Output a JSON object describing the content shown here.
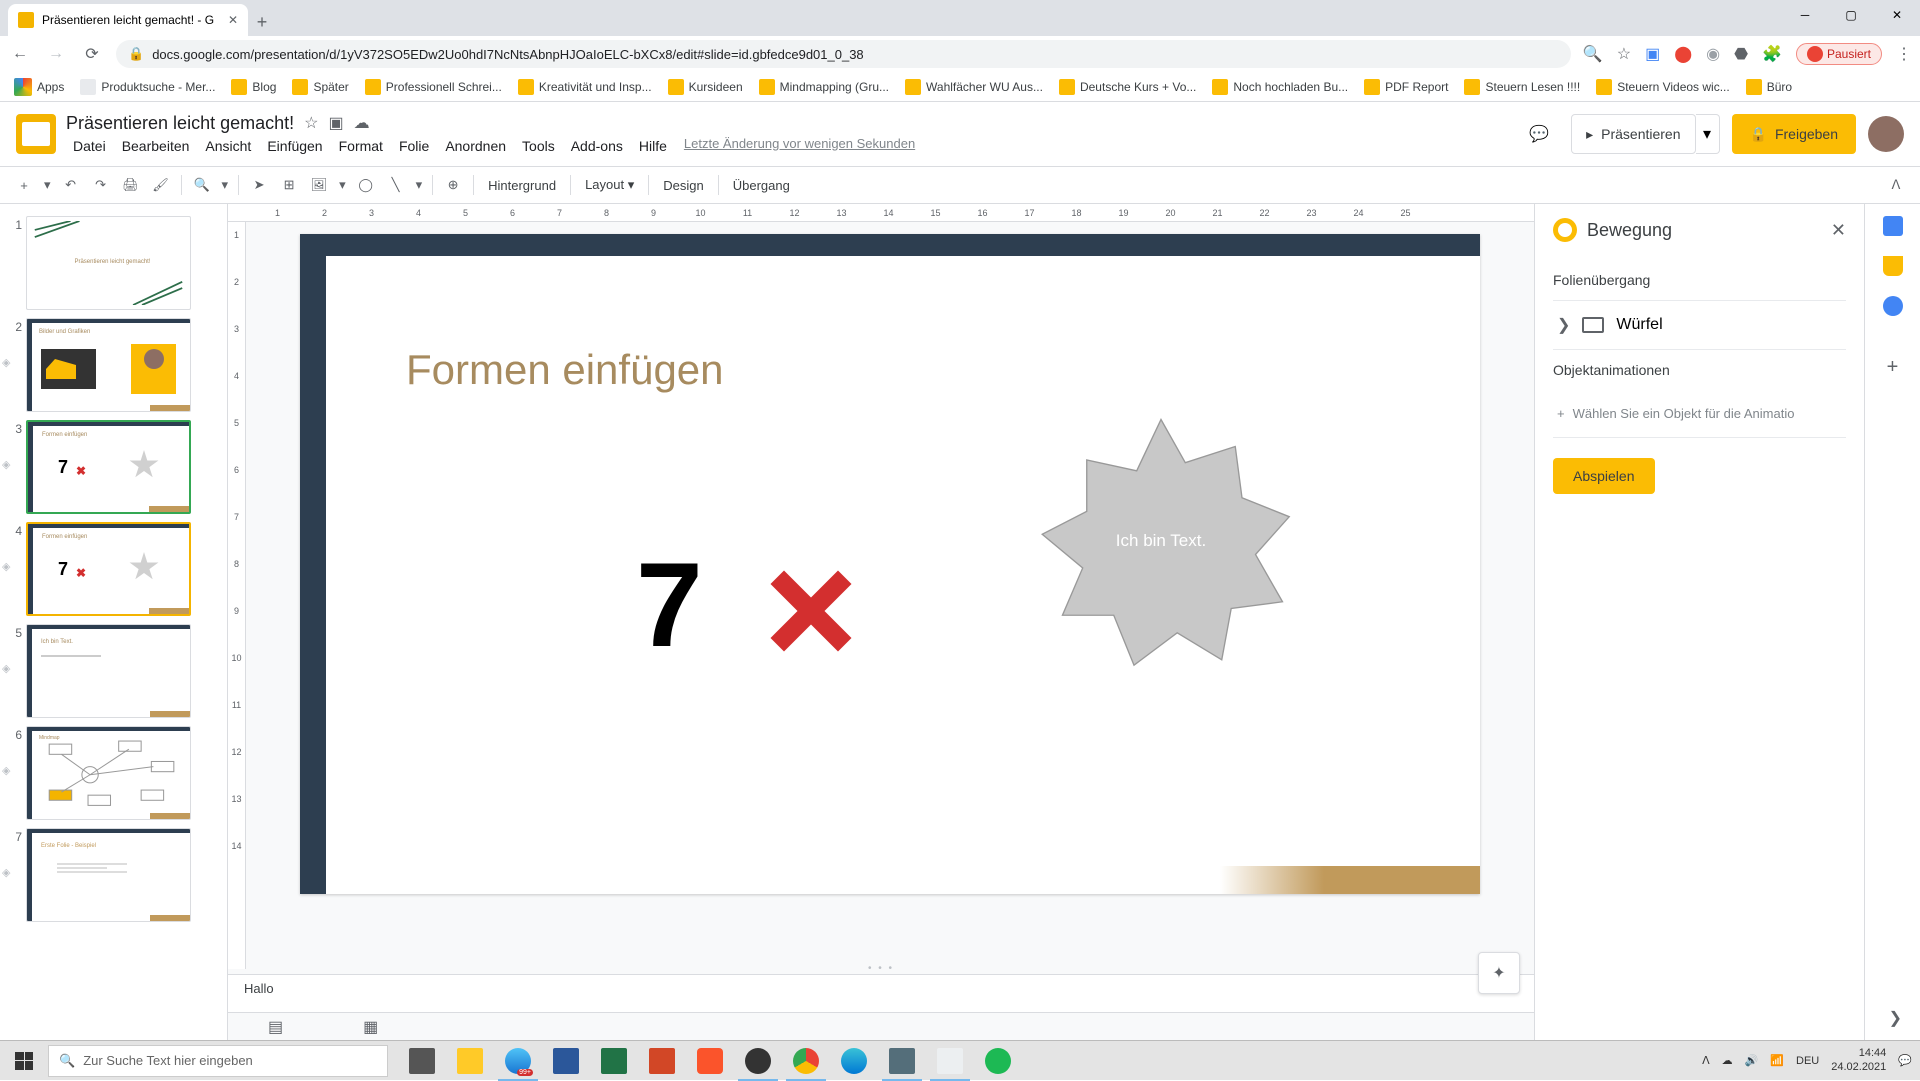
{
  "browser": {
    "tab_title": "Präsentieren leicht gemacht! - G",
    "url": "docs.google.com/presentation/d/1yV372SO5EDw2Uo0hdI7NcNtsAbnpHJOaIoELC-bXCx8/edit#slide=id.gbfedce9d01_0_38",
    "profile_status": "Pausiert"
  },
  "bookmarks": {
    "apps": "Apps",
    "items": [
      "Produktsuche - Mer...",
      "Blog",
      "Später",
      "Professionell Schrei...",
      "Kreativität und Insp...",
      "Kursideen",
      "Mindmapping  (Gru...",
      "Wahlfächer WU Aus...",
      "Deutsche Kurs + Vo...",
      "Noch hochladen Bu...",
      "PDF Report",
      "Steuern Lesen !!!!",
      "Steuern Videos wic...",
      "Büro"
    ]
  },
  "doc": {
    "title": "Präsentieren leicht gemacht!",
    "menus": [
      "Datei",
      "Bearbeiten",
      "Ansicht",
      "Einfügen",
      "Format",
      "Folie",
      "Anordnen",
      "Tools",
      "Add-ons",
      "Hilfe"
    ],
    "last_change": "Letzte Änderung vor wenigen Sekunden",
    "present": "Präsentieren",
    "share": "Freigeben"
  },
  "toolbar": {
    "background": "Hintergrund",
    "layout": "Layout",
    "design": "Design",
    "transition": "Übergang"
  },
  "ruler_h": [
    "1",
    "2",
    "3",
    "4",
    "5",
    "6",
    "7",
    "8",
    "9",
    "10",
    "11",
    "12",
    "13",
    "14",
    "15",
    "16",
    "17",
    "18",
    "19",
    "20",
    "21",
    "22",
    "23",
    "24",
    "25"
  ],
  "ruler_v": [
    "1",
    "2",
    "3",
    "4",
    "5",
    "6",
    "7",
    "8",
    "9",
    "10",
    "11",
    "12",
    "13",
    "14"
  ],
  "slide": {
    "title": "Formen einfügen",
    "big_number": "7",
    "star_text": "Ich bin Text."
  },
  "notes": "Hallo",
  "motion": {
    "title": "Bewegung",
    "section_transition": "Folienübergang",
    "transition_name": "Würfel",
    "section_animations": "Objektanimationen",
    "select_hint": "Wählen Sie ein Objekt für die Animatio",
    "play": "Abspielen"
  },
  "thumbs": {
    "t1": "Präsentieren leicht gemacht!",
    "t2": "Bilder und Grafiken",
    "t3_title": "Formen einfügen",
    "t3_num": "7",
    "t4_title": "Formen einfügen",
    "t4_num": "7",
    "t5": "Ich bin Text.",
    "t6": "Mindmap",
    "t7_title": "Erste Folie - Beispiel",
    "nums": [
      "1",
      "2",
      "3",
      "4",
      "5",
      "6",
      "7"
    ]
  },
  "taskbar": {
    "search_placeholder": "Zur Suche Text hier eingeben",
    "badge": "99+",
    "lang": "DEU",
    "time": "14:44",
    "date": "24.02.2021"
  }
}
